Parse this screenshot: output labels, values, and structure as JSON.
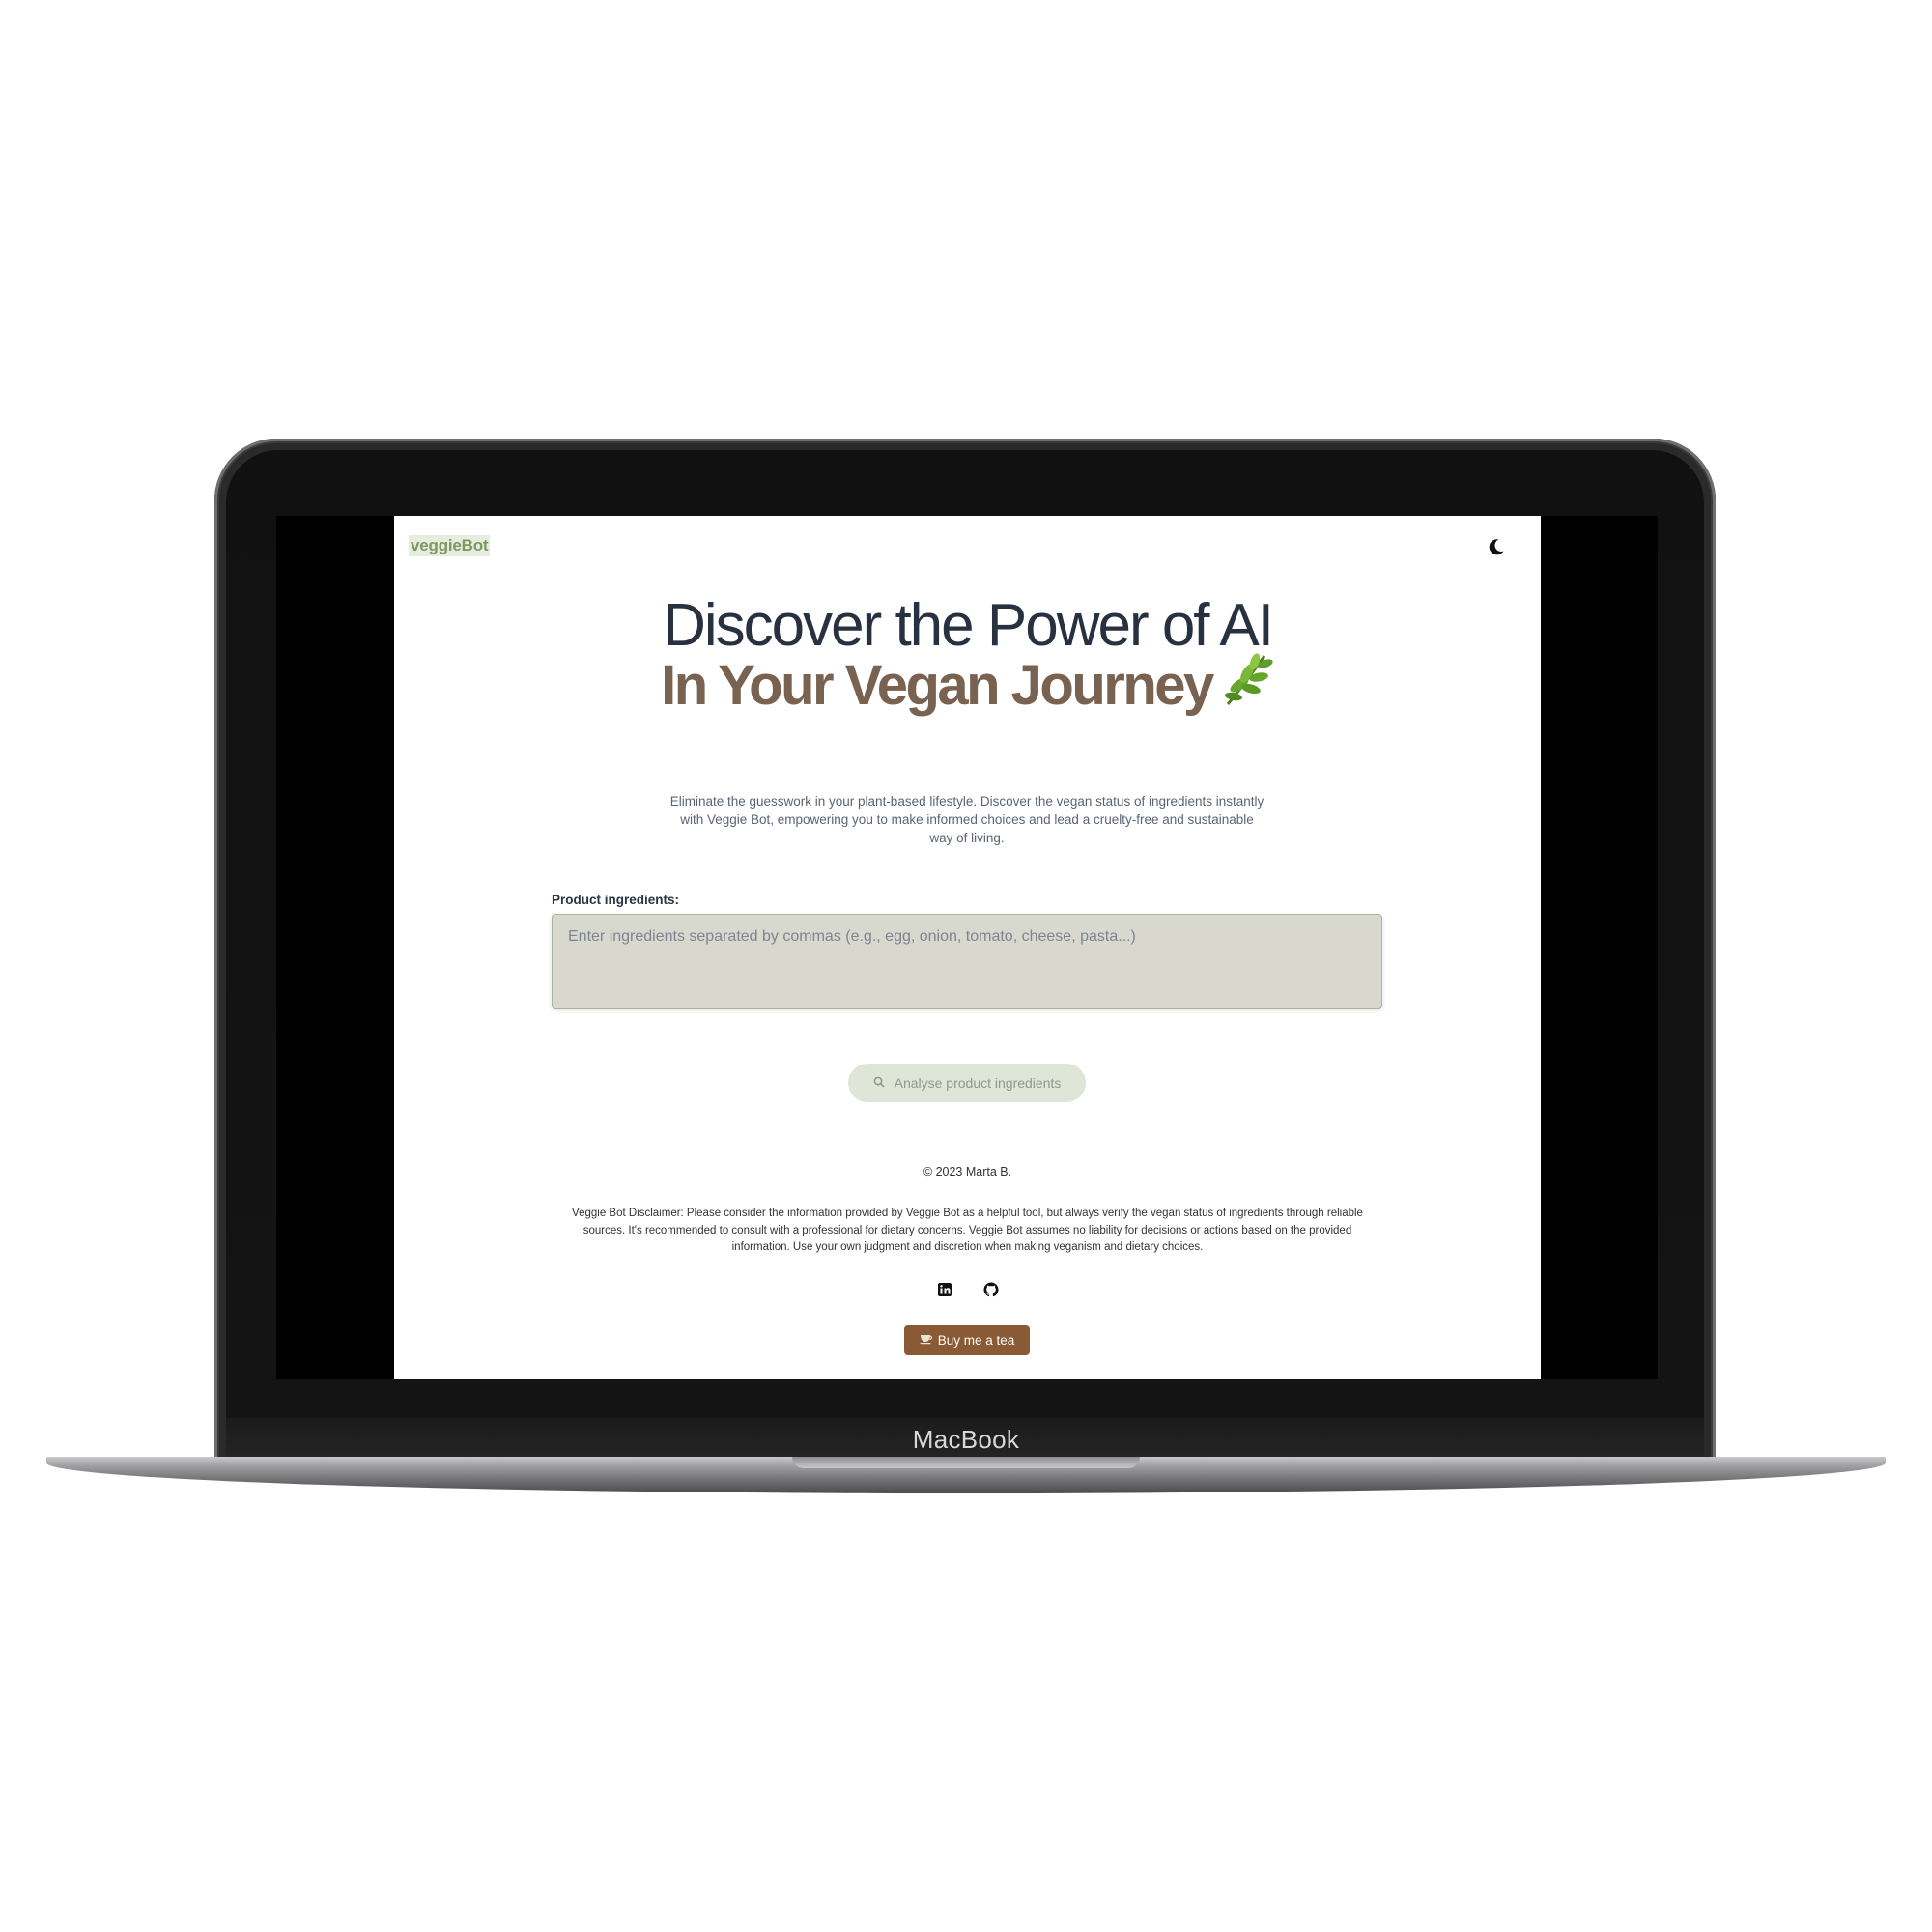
{
  "device": {
    "brand_label": "MacBook"
  },
  "header": {
    "logo_text": "veggieBot",
    "theme_toggle_icon": "moon-icon"
  },
  "hero": {
    "line1": "Discover the Power of AI",
    "line2": "In Your Vegan Journey",
    "emoji_icon": "herb-leaf-icon"
  },
  "intro": {
    "text": "Eliminate the guesswork in your plant-based lifestyle. Discover the vegan status of ingredients instantly with Veggie Bot, empowering you to make informed choices and lead a cruelty-free and sustainable way of living."
  },
  "form": {
    "label": "Product ingredients:",
    "value": "",
    "placeholder": "Enter ingredients separated by commas (e.g., egg, onion, tomato, cheese, pasta...)",
    "submit_label": "Analyse product ingredients",
    "submit_icon": "magnifier-icon"
  },
  "footer": {
    "copyright": "© 2023 Marta B.",
    "disclaimer": "Veggie Bot Disclaimer: Please consider the information provided by Veggie Bot as a helpful tool, but always verify the vegan status of ingredients through reliable sources. It's recommended to consult with a professional for dietary concerns. Veggie Bot assumes no liability for decisions or actions based on the provided information. Use your own judgment and discretion when making veganism and dietary choices.",
    "social_icons": [
      "linkedin-icon",
      "github-icon"
    ],
    "tea_button_label": "Buy me a tea",
    "tea_button_icon": "teacup-icon"
  },
  "colors": {
    "logo": "#7d9a5e",
    "hero_primary": "#28313f",
    "hero_accent": "#7a6251",
    "input_bg": "#d9d8cf",
    "button_disabled_bg": "#dfe5d7",
    "tea_button_bg": "#8a5a34"
  }
}
